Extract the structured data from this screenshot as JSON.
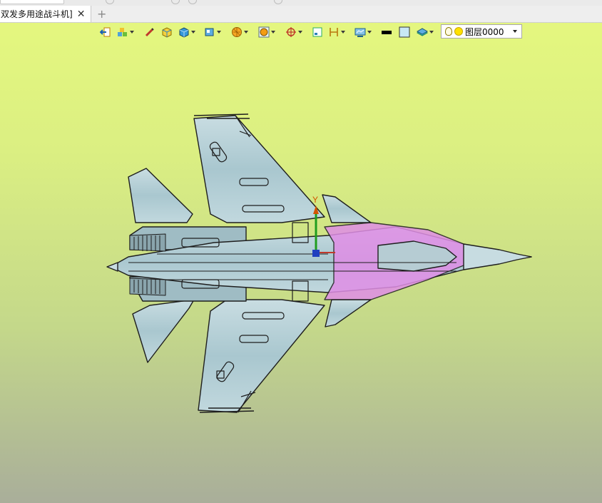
{
  "document_tab": {
    "title": "双发多用途战斗机]",
    "close_glyph": "✕"
  },
  "new_tab_glyph": "+",
  "toolbar": {
    "tools": [
      {
        "icon": "exit-arrow-icon",
        "has_dropdown": false
      },
      {
        "icon": "blocks-stack-icon",
        "has_dropdown": true
      },
      {
        "icon": "pencil-icon",
        "has_dropdown": false
      },
      {
        "icon": "cube-yellow-icon",
        "has_dropdown": false
      },
      {
        "icon": "cube-blue-icon",
        "has_dropdown": true
      },
      {
        "icon": "view-box-icon",
        "has_dropdown": true
      },
      {
        "icon": "sphere-orange-icon",
        "has_dropdown": true
      },
      {
        "icon": "sphere-frame-icon",
        "has_dropdown": true
      },
      {
        "icon": "crosshair-icon",
        "has_dropdown": true
      },
      {
        "icon": "frame-icon",
        "has_dropdown": false
      },
      {
        "icon": "dimension-icon",
        "has_dropdown": true
      },
      {
        "icon": "display-settings-icon",
        "has_dropdown": true
      },
      {
        "icon": "black-line-swatch-icon",
        "has_dropdown": false
      },
      {
        "icon": "color-swatch-icon",
        "has_dropdown": false
      },
      {
        "icon": "layer-stack-icon",
        "has_dropdown": true
      }
    ],
    "layer_selector": {
      "value": "图层0000",
      "icons": [
        "lightbulb-icon",
        "sun-icon"
      ]
    }
  },
  "viewport": {
    "model": "fighter-jet-3d-model",
    "axis_label_y": "Y",
    "colors": {
      "airframe": "#b3cfd6",
      "airframe_dark": "#8fb0ba",
      "canopy_highlight": "#e08ee6",
      "outline": "#1e1e1e"
    }
  }
}
